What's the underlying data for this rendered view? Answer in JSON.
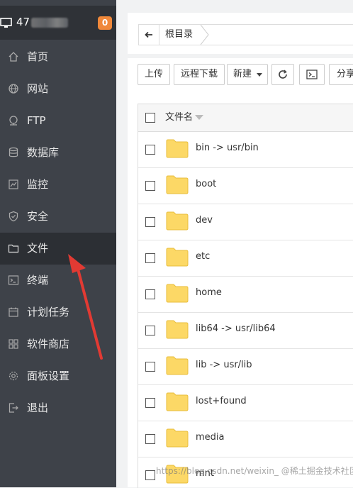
{
  "sidebar": {
    "server_ip": "47",
    "badge_count": "0",
    "items": [
      {
        "label": "首页",
        "icon": "home-icon"
      },
      {
        "label": "网站",
        "icon": "globe-icon"
      },
      {
        "label": "FTP",
        "icon": "ftp-icon"
      },
      {
        "label": "数据库",
        "icon": "database-icon"
      },
      {
        "label": "监控",
        "icon": "monitor-icon"
      },
      {
        "label": "安全",
        "icon": "shield-icon"
      },
      {
        "label": "文件",
        "icon": "folder-icon",
        "active": true
      },
      {
        "label": "终端",
        "icon": "terminal-icon"
      },
      {
        "label": "计划任务",
        "icon": "calendar-icon"
      },
      {
        "label": "软件商店",
        "icon": "apps-icon"
      },
      {
        "label": "面板设置",
        "icon": "gear-icon"
      },
      {
        "label": "退出",
        "icon": "logout-icon"
      }
    ]
  },
  "path_bar": {
    "back_icon": "arrow-left-icon",
    "root_label": "根目录"
  },
  "toolbar": {
    "upload": "上传",
    "remote_download": "远程下载",
    "new": "新建",
    "refresh_icon": "refresh-icon",
    "terminal_icon": "terminal-icon",
    "share": "分享"
  },
  "file_table": {
    "column_name": "文件名",
    "files": [
      "bin -> usr/bin",
      "boot",
      "dev",
      "etc",
      "home",
      "lib64 -> usr/lib64",
      "lib -> usr/lib",
      "lost+found",
      "media",
      "mnt"
    ]
  },
  "watermark": "https://blog.csdn.net/weixin_ @稀土掘金技术社区",
  "colors": {
    "sidebar_bg": "#3e4249",
    "sidebar_active": "#2c2f34",
    "badge": "#f0883a",
    "folder": "#fcd866",
    "annotation_arrow": "#e23a33"
  }
}
